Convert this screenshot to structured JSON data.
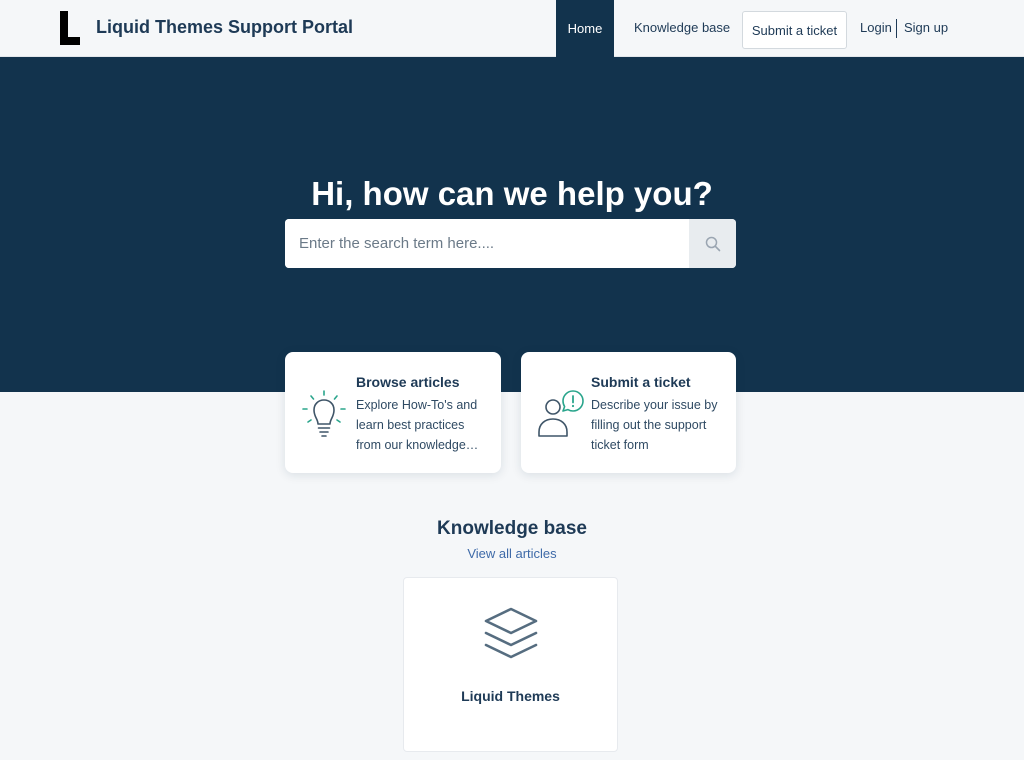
{
  "header": {
    "brand": "Liquid Themes Support Portal",
    "nav": {
      "home": "Home",
      "knowledge_base": "Knowledge base",
      "submit_ticket": "Submit a ticket",
      "login": "Login",
      "signup": "Sign up"
    }
  },
  "hero": {
    "title": "Hi, how can we help you?",
    "search": {
      "placeholder": "Enter the search term here....",
      "value": "",
      "button_icon": "search-icon"
    }
  },
  "cards": [
    {
      "icon": "lightbulb-icon",
      "title": "Browse articles",
      "description": "Explore How-To's and learn best practices from our knowledge base"
    },
    {
      "icon": "user-alert-icon",
      "title": "Submit a ticket",
      "description": "Describe your issue by filling out the support ticket form"
    }
  ],
  "knowledge_base": {
    "title": "Knowledge base",
    "view_all": "View all articles",
    "categories": [
      {
        "icon": "layers-icon",
        "label": "Liquid Themes"
      }
    ]
  },
  "colors": {
    "primary": "#12334d",
    "background": "#f5f7f9",
    "text": "#1e3a56",
    "accent": "#2aa58c",
    "link": "#3e6aa8"
  }
}
